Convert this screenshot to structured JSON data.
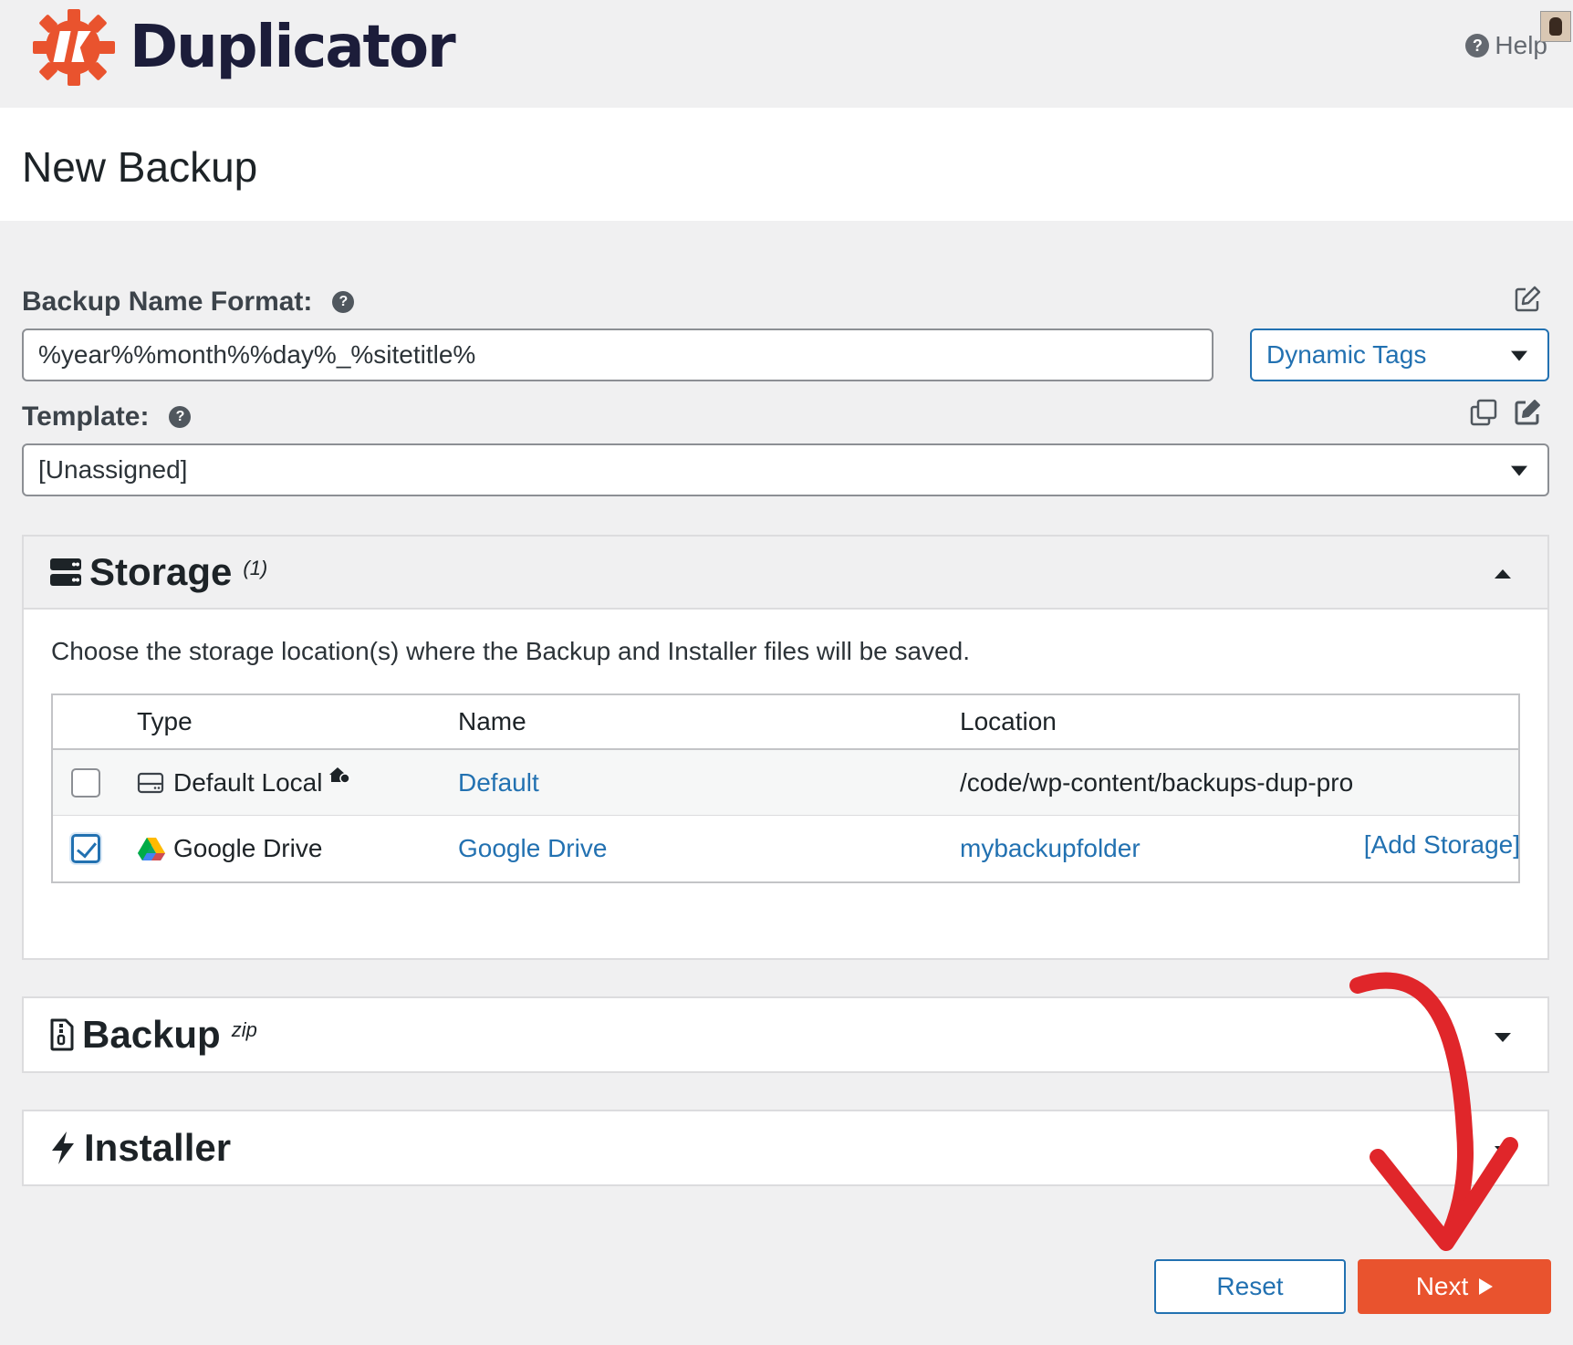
{
  "brand": {
    "name": "Duplicator",
    "logo_color": "#e9532e"
  },
  "header": {
    "help_label": "Help"
  },
  "page": {
    "title": "New Backup"
  },
  "name_format": {
    "label": "Backup Name Format:",
    "value": "%year%%month%%day%_%sitetitle%",
    "dynamic_tags_label": "Dynamic Tags"
  },
  "template": {
    "label": "Template:",
    "value": "[Unassigned]"
  },
  "storage": {
    "title": "Storage",
    "count": "(1)",
    "description": "Choose the storage location(s) where the Backup and Installer files will be saved.",
    "columns": {
      "type": "Type",
      "name": "Name",
      "location": "Location"
    },
    "rows": [
      {
        "checked": false,
        "type": "Default Local",
        "name": "Default",
        "location": "/code/wp-content/backups-dup-pro"
      },
      {
        "checked": true,
        "type": "Google Drive",
        "name": "Google Drive",
        "location": "mybackupfolder"
      }
    ],
    "add_label": "[Add Storage]"
  },
  "backup": {
    "title": "Backup",
    "sup": "zip"
  },
  "installer": {
    "title": "Installer"
  },
  "actions": {
    "reset_label": "Reset",
    "next_label": "Next"
  },
  "colors": {
    "accent": "#2271b1",
    "primary_button": "#e9532e",
    "annotation_arrow": "#e0262a"
  }
}
